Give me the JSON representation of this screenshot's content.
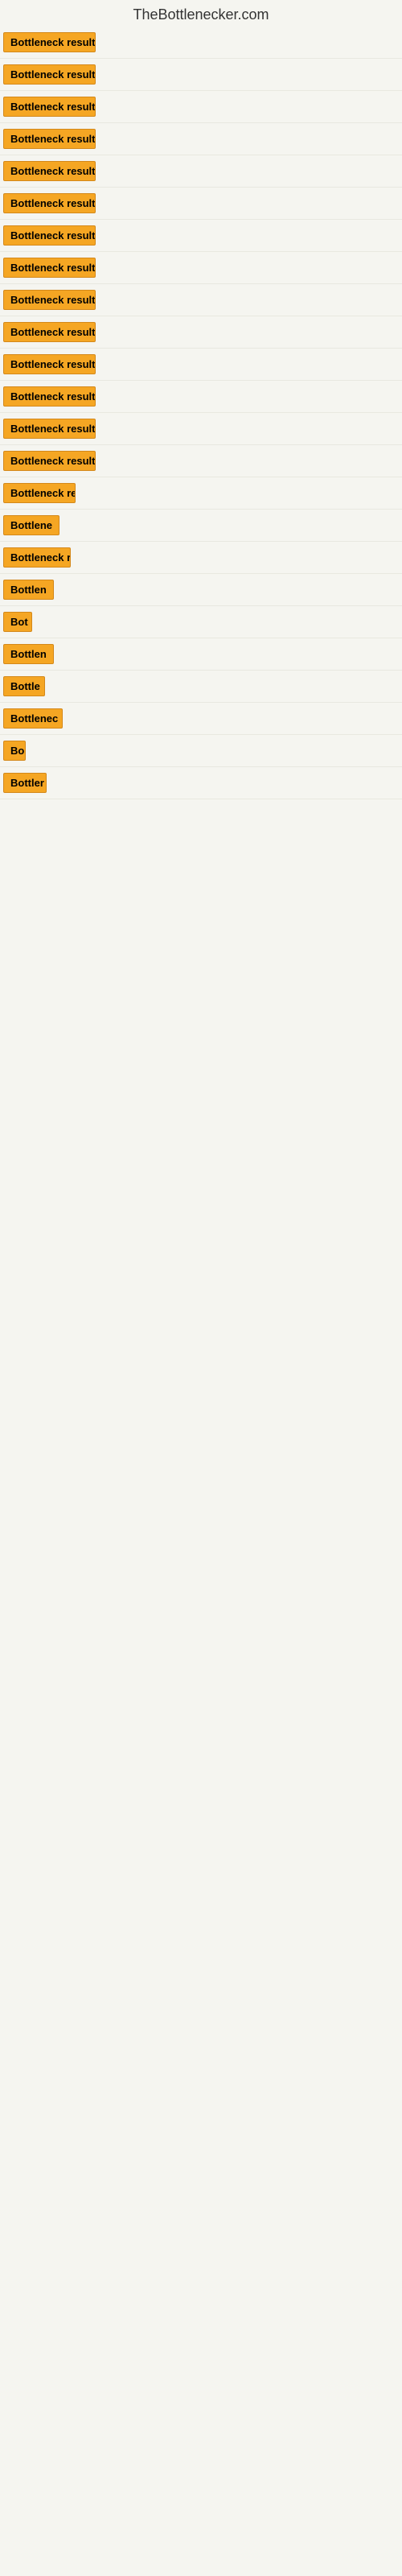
{
  "site": {
    "title": "TheBottlenecker.com"
  },
  "rows": [
    {
      "id": 1,
      "label": "Bottleneck result",
      "width": 115
    },
    {
      "id": 2,
      "label": "Bottleneck result",
      "width": 115
    },
    {
      "id": 3,
      "label": "Bottleneck result",
      "width": 115
    },
    {
      "id": 4,
      "label": "Bottleneck result",
      "width": 115
    },
    {
      "id": 5,
      "label": "Bottleneck result",
      "width": 115
    },
    {
      "id": 6,
      "label": "Bottleneck result",
      "width": 115
    },
    {
      "id": 7,
      "label": "Bottleneck result",
      "width": 115
    },
    {
      "id": 8,
      "label": "Bottleneck result",
      "width": 115
    },
    {
      "id": 9,
      "label": "Bottleneck result",
      "width": 115
    },
    {
      "id": 10,
      "label": "Bottleneck result",
      "width": 115
    },
    {
      "id": 11,
      "label": "Bottleneck result",
      "width": 115
    },
    {
      "id": 12,
      "label": "Bottleneck result",
      "width": 115
    },
    {
      "id": 13,
      "label": "Bottleneck result",
      "width": 115
    },
    {
      "id": 14,
      "label": "Bottleneck result",
      "width": 115
    },
    {
      "id": 15,
      "label": "Bottleneck re",
      "width": 90
    },
    {
      "id": 16,
      "label": "Bottlene",
      "width": 72
    },
    {
      "id": 17,
      "label": "Bottleneck r",
      "width": 84
    },
    {
      "id": 18,
      "label": "Bottlen",
      "width": 63
    },
    {
      "id": 19,
      "label": "Bot",
      "width": 36
    },
    {
      "id": 20,
      "label": "Bottlen",
      "width": 63
    },
    {
      "id": 21,
      "label": "Bottle",
      "width": 52
    },
    {
      "id": 22,
      "label": "Bottlenec",
      "width": 74
    },
    {
      "id": 23,
      "label": "Bo",
      "width": 28
    },
    {
      "id": 24,
      "label": "Bottler",
      "width": 54
    }
  ]
}
